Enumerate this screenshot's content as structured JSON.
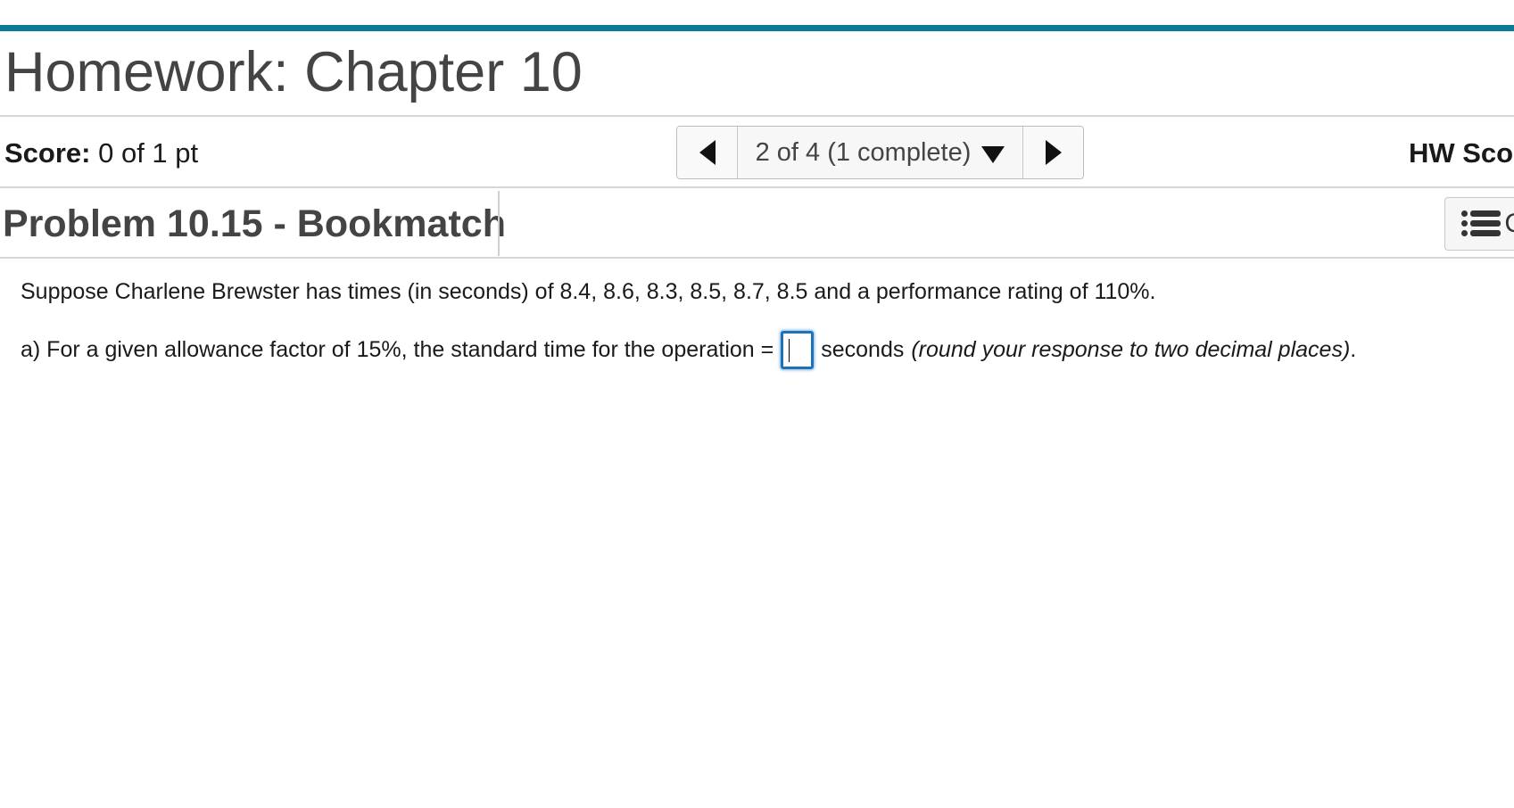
{
  "header": {
    "title": "Homework: Chapter 10",
    "accent_color": "#0b7a96"
  },
  "score": {
    "label": "Score:",
    "value": "0 of 1 pt"
  },
  "pager": {
    "status": "2 of 4 (1 complete)",
    "prev_icon": "triangle-left-icon",
    "next_icon": "triangle-right-icon",
    "dropdown_icon": "triangle-down-icon"
  },
  "hw_score": {
    "label": "HW Sco"
  },
  "problem": {
    "title": "Problem 10.15 - Bookmatch",
    "menu_icon": "list-icon",
    "menu_label_fragment": "C",
    "statement": "Suppose Charlene Brewster has times (in seconds) of 8.4, 8.6, 8.3, 8.5, 8.7, 8.5 and a performance rating of 110%.",
    "part_a": {
      "prefix": "a) For a given allowance factor of 15%, the standard time for the operation =",
      "answer_value": "",
      "unit": "seconds",
      "hint": "(round your response to two decimal places)",
      "terminal": "."
    }
  }
}
